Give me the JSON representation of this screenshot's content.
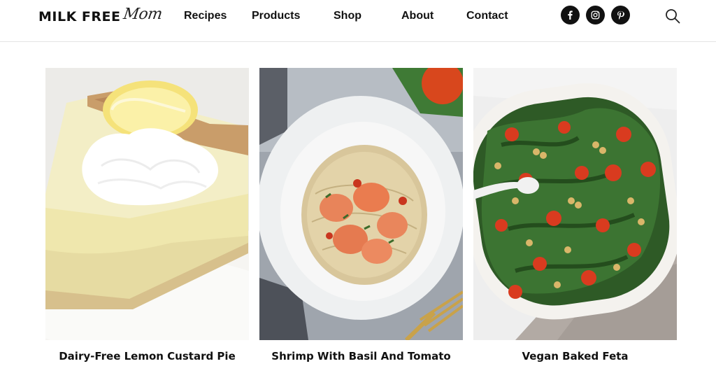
{
  "brand": {
    "main": "MILK FREE",
    "script": "Mom"
  },
  "nav": [
    {
      "label": "Recipes"
    },
    {
      "label": "Products"
    },
    {
      "label": "Shop"
    },
    {
      "label": "About"
    },
    {
      "label": "Contact"
    }
  ],
  "social": [
    {
      "icon": "facebook-icon",
      "glyph": "f"
    },
    {
      "icon": "instagram-icon"
    },
    {
      "icon": "pinterest-icon",
      "glyph": "p"
    }
  ],
  "search": {
    "icon": "search-icon"
  },
  "recipes": [
    {
      "title": "Dairy-Free Lemon Custard Pie"
    },
    {
      "title": "Shrimp With Basil And Tomato"
    },
    {
      "title": "Vegan Baked Feta"
    }
  ],
  "colors": {
    "text": "#111111",
    "divider": "#e4e4e4",
    "social_bg": "#111111"
  }
}
